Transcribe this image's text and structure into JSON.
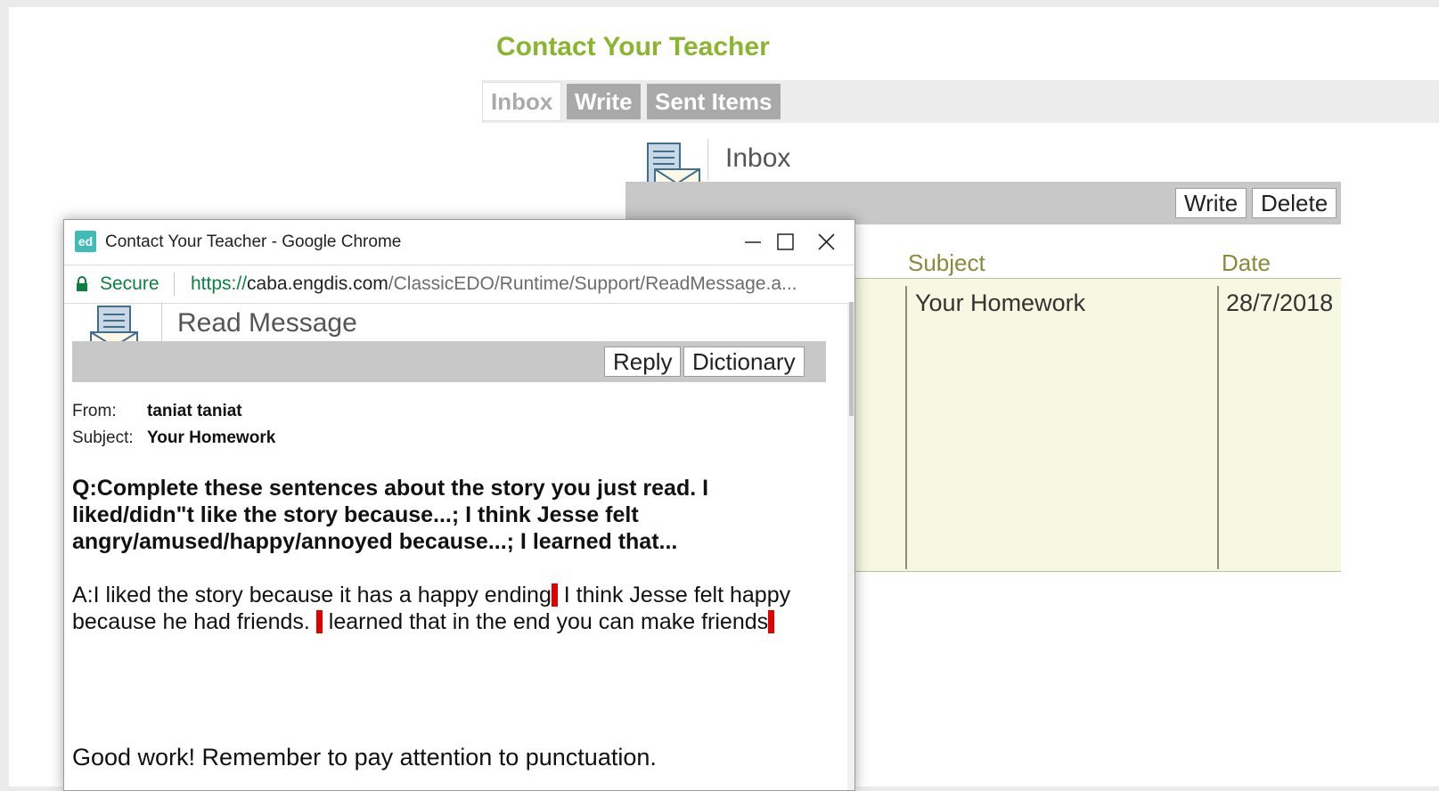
{
  "app": {
    "title": "Contact Your Teacher",
    "tabs": [
      {
        "label": "Inbox",
        "active": true
      },
      {
        "label": "Write",
        "active": false
      },
      {
        "label": "Sent Items",
        "active": false
      }
    ]
  },
  "inbox": {
    "title": "Inbox",
    "write_label": "Write",
    "delete_label": "Delete",
    "columns": [
      "Subject",
      "Date"
    ],
    "rows": [
      {
        "subject": "Your Homework",
        "date": "28/7/2018"
      }
    ]
  },
  "popup": {
    "window_title": "Contact Your Teacher - Google Chrome",
    "app_icon_text": "ed",
    "secure_label": "Secure",
    "url_scheme": "https://",
    "url_host": "caba.engdis.com",
    "url_path": "/ClassicEDO/Runtime/Support/ReadMessage.a...",
    "read_title": "Read Message",
    "reply_label": "Reply",
    "dictionary_label": "Dictionary",
    "from_label": "From:",
    "from_value": "taniat taniat",
    "subject_label": "Subject:",
    "subject_value": "Your Homework",
    "question": "Q:Complete these sentences about the story you just read. I liked/didn\"t like the story because...; I think Jesse felt angry/amused/happy/annoyed because...; I learned that...",
    "answer_part1": "A:I liked the story because it has a happy ending",
    "answer_part2": " I think Jesse felt happy because he had friends. ",
    "answer_part3": " learned that in the end you can make friends",
    "feedback": "Good work! Remember to pay attention to punctuation."
  },
  "colors": {
    "title_green": "#8ab52f",
    "table_bg": "#f7f8e1",
    "error_mark": "#e00000",
    "secure_green": "#0b8043"
  }
}
